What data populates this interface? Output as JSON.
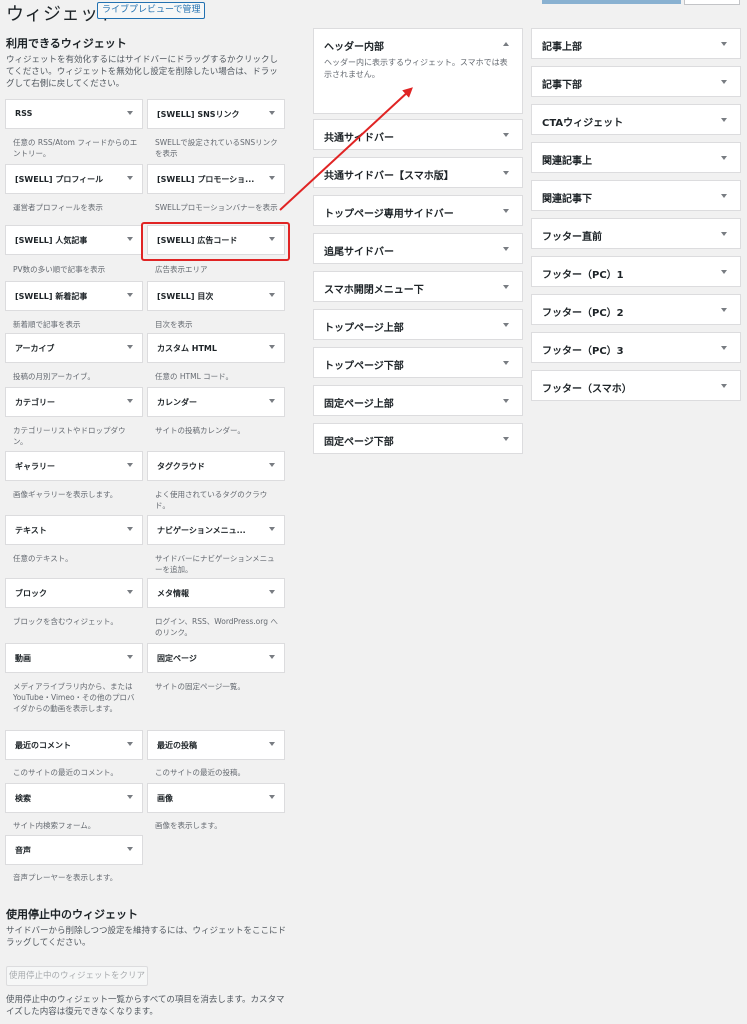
{
  "header": {
    "title": "ウィジェット",
    "preview_button": "ライブプレビューで管理"
  },
  "available": {
    "heading": "利用できるウィジェット",
    "description": "ウィジェットを有効化するにはサイドバーにドラッグするかクリックしてください。ウィジェットを無効化し設定を削除したい場合は、ドラッグして右側に戻してください。",
    "widgets": [
      {
        "title": "RSS",
        "desc": "任意の RSS/Atom フィードからのエントリー。"
      },
      {
        "title": "[SWELL] SNSリンク",
        "desc": "SWELLで設定されているSNSリンクを表示"
      },
      {
        "title": "[SWELL] プロフィール",
        "desc": "運営者プロフィールを表示"
      },
      {
        "title": "[SWELL] プロモーショ...",
        "desc": "SWELLプロモーションバナーを表示"
      },
      {
        "title": "[SWELL] 人気記事",
        "desc": "PV数の多い順で記事を表示"
      },
      {
        "title": "[SWELL] 広告コード",
        "desc": "広告表示エリア"
      },
      {
        "title": "[SWELL] 新着記事",
        "desc": "新着順で記事を表示"
      },
      {
        "title": "[SWELL] 目次",
        "desc": "目次を表示"
      },
      {
        "title": "アーカイブ",
        "desc": "投稿の月別アーカイブ。"
      },
      {
        "title": "カスタム HTML",
        "desc": "任意の HTML コード。"
      },
      {
        "title": "カテゴリー",
        "desc": "カテゴリーリストやドロップダウン。"
      },
      {
        "title": "カレンダー",
        "desc": "サイトの投稿カレンダー。"
      },
      {
        "title": "ギャラリー",
        "desc": "画像ギャラリーを表示します。"
      },
      {
        "title": "タグクラウド",
        "desc": "よく使用されているタグのクラウド。"
      },
      {
        "title": "テキスト",
        "desc": "任意のテキスト。"
      },
      {
        "title": "ナビゲーションメニュ...",
        "desc": "サイドバーにナビゲーションメニューを追加。"
      },
      {
        "title": "ブロック",
        "desc": "ブロックを含むウィジェット。"
      },
      {
        "title": "メタ情報",
        "desc": "ログイン、RSS、WordPress.org へのリンク。"
      },
      {
        "title": "動画",
        "desc": "メディアライブラリ内から、または YouTube・Vimeo・その他のプロバイダからの動画を表示します。"
      },
      {
        "title": "固定ページ",
        "desc": "サイトの固定ページ一覧。"
      },
      {
        "title": "最近のコメント",
        "desc": "このサイトの最近のコメント。"
      },
      {
        "title": "最近の投稿",
        "desc": "このサイトの最近の投稿。"
      },
      {
        "title": "検索",
        "desc": "サイト内検索フォーム。"
      },
      {
        "title": "画像",
        "desc": "画像を表示します。"
      },
      {
        "title": "音声",
        "desc": "音声プレーヤーを表示します。"
      }
    ]
  },
  "inactive": {
    "heading": "使用停止中のウィジェット",
    "description": "サイドバーから削除しつつ設定を維持するには、ウィジェットをここにドラッグしてください。",
    "clear_button": "使用停止中のウィジェットをクリア",
    "note": "使用停止中のウィジェット一覧からすべての項目を消去します。カスタマイズした内容は復元できなくなります。"
  },
  "areas_col1": [
    {
      "title": "ヘッダー内部",
      "desc": "ヘッダー内に表示するウィジェット。スマホでは表示されません。",
      "open": true
    },
    {
      "title": "共通サイドバー"
    },
    {
      "title": "共通サイドバー【スマホ版】"
    },
    {
      "title": "トップページ専用サイドバー"
    },
    {
      "title": "追尾サイドバー"
    },
    {
      "title": "スマホ開閉メニュー下"
    },
    {
      "title": "トップページ上部"
    },
    {
      "title": "トップページ下部"
    },
    {
      "title": "固定ページ上部"
    },
    {
      "title": "固定ページ下部"
    }
  ],
  "areas_col2": [
    {
      "title": "記事上部"
    },
    {
      "title": "記事下部"
    },
    {
      "title": "CTAウィジェット"
    },
    {
      "title": "関連記事上"
    },
    {
      "title": "関連記事下"
    },
    {
      "title": "フッター直前"
    },
    {
      "title": "フッター（PC）1"
    },
    {
      "title": "フッター（PC）2"
    },
    {
      "title": "フッター（PC）3"
    },
    {
      "title": "フッター（スマホ）"
    }
  ],
  "colors": {
    "highlight": "#e02424",
    "link": "#2271b1"
  }
}
